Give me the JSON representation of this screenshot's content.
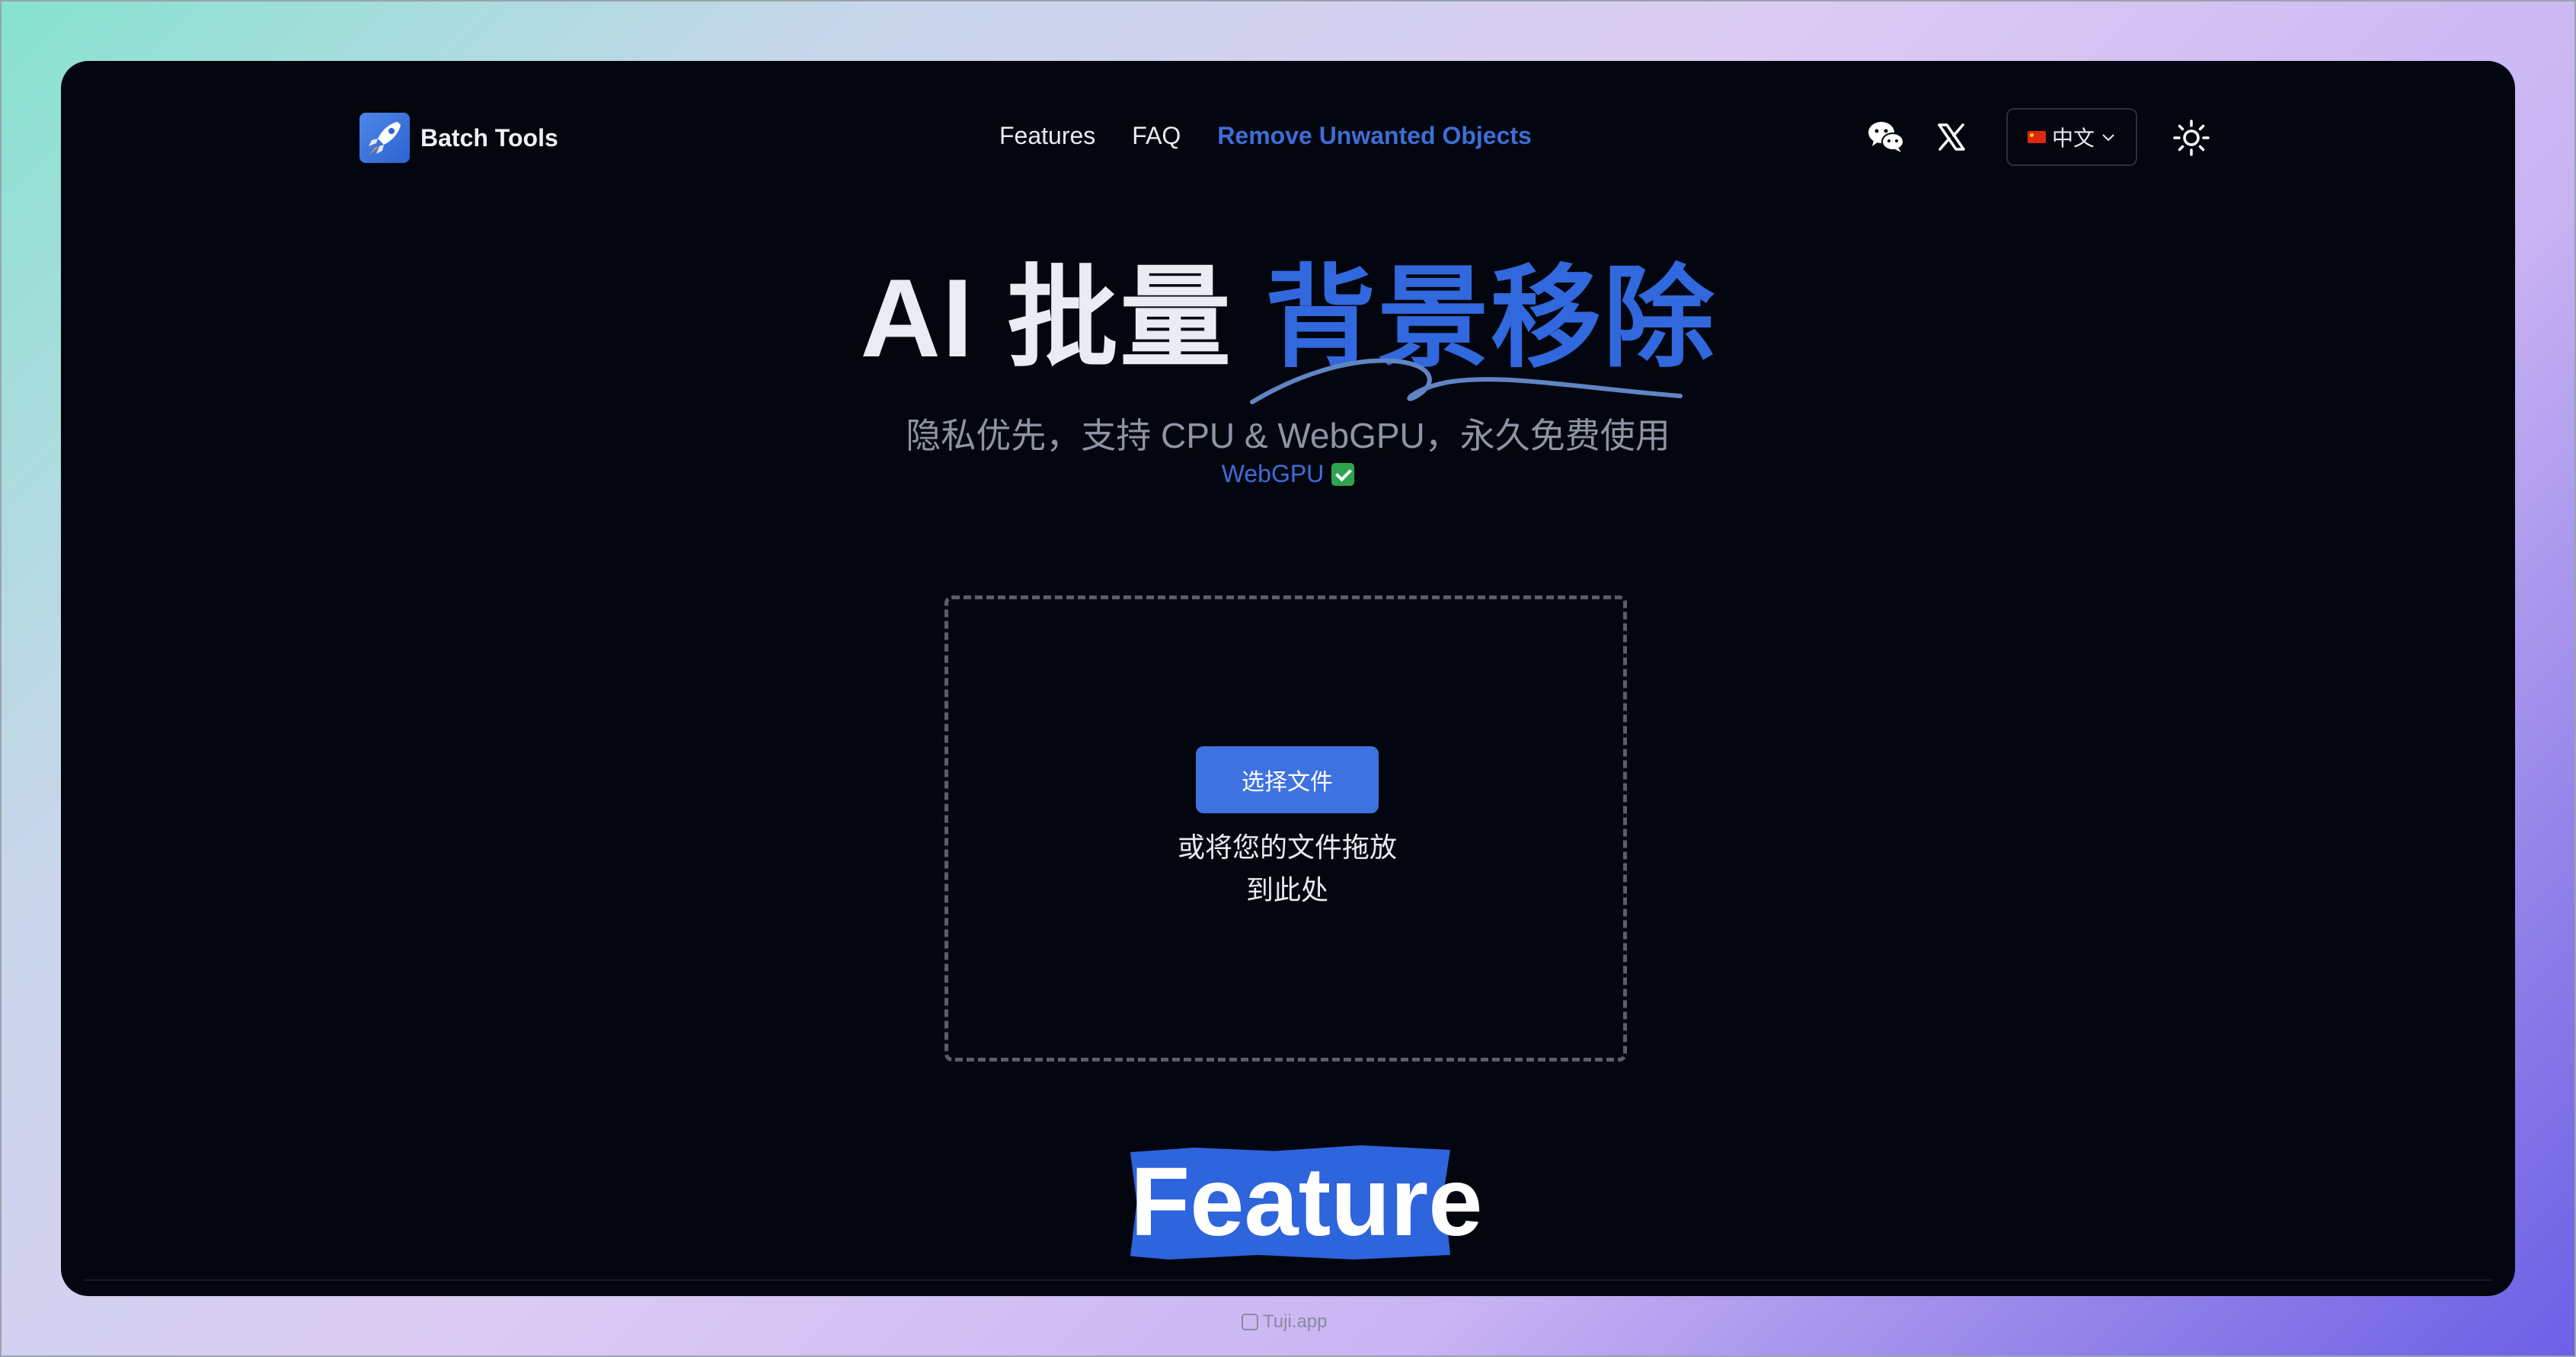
{
  "header": {
    "brand": "Batch Tools",
    "nav": {
      "features": "Features",
      "faq": "FAQ",
      "remove_objects": "Remove Unwanted Objects"
    },
    "language": "中文",
    "icons": [
      "wechat-icon",
      "x-icon",
      "sun-icon"
    ]
  },
  "hero": {
    "title_prefix": "AI 批量",
    "title_accent": "背景移除",
    "subtitle": "隐私优先，支持 CPU & WebGPU，永久免费使用",
    "gpu_label": "WebGPU"
  },
  "upload": {
    "button_label": "选择文件",
    "hint_line1": "或将您的文件拖放",
    "hint_line2": "到此处"
  },
  "feature": {
    "heading": "Feature"
  },
  "watermark": "Tuji.app",
  "colors": {
    "accent": "#3168dd",
    "window_bg": "#03060f",
    "button": "#3d72e0"
  }
}
